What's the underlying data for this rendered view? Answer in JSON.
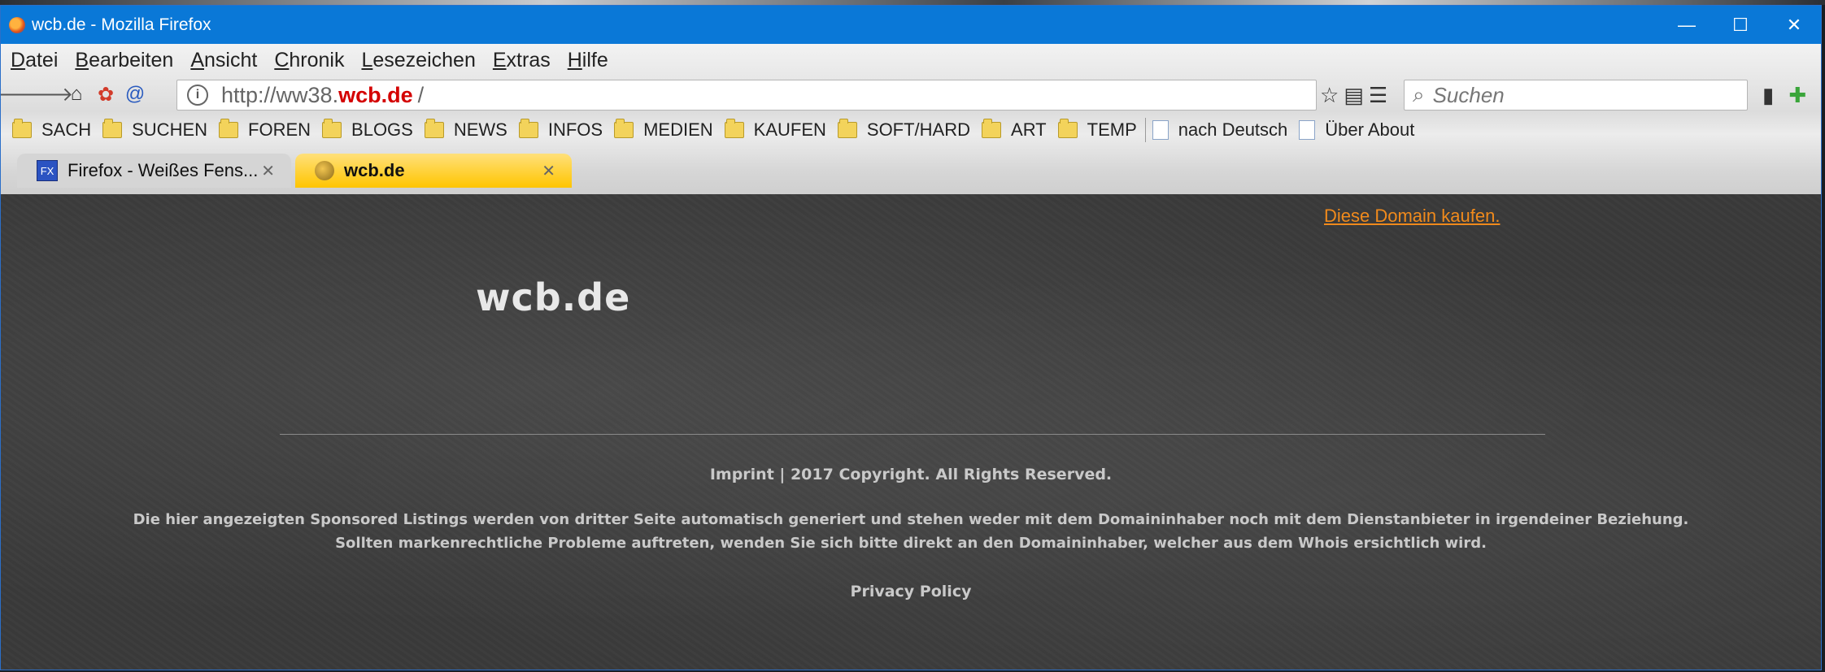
{
  "window": {
    "title": "wcb.de - Mozilla Firefox",
    "controls": {
      "minimize": "—",
      "maximize": "☐",
      "close": "✕"
    }
  },
  "menubar": {
    "items": [
      {
        "first": "D",
        "rest": "atei"
      },
      {
        "first": "B",
        "rest": "earbeiten"
      },
      {
        "first": "A",
        "rest": "nsicht"
      },
      {
        "first": "C",
        "rest": "hronik"
      },
      {
        "first": "L",
        "rest": "esezeichen"
      },
      {
        "first": "E",
        "rest": "xtras"
      },
      {
        "first": "H",
        "rest": "ilfe"
      }
    ]
  },
  "navbar": {
    "url_prefix": "http://ww38.",
    "url_domain": "wcb.de",
    "url_suffix": "/",
    "search_placeholder": "Suchen"
  },
  "bookmarks": {
    "folders": [
      "SACH",
      "SUCHEN",
      "FOREN",
      "BLOGS",
      "NEWS",
      "INFOS",
      "MEDIEN",
      "KAUFEN",
      "SOFT/HARD",
      "ART",
      "TEMP"
    ],
    "pages": [
      "nach Deutsch",
      "Über About"
    ]
  },
  "tabs": [
    {
      "label": "Firefox - Weißes Fens...",
      "favicon": "FX"
    },
    {
      "label": "wcb.de",
      "active": true
    }
  ],
  "page": {
    "buy_link": "Diese Domain kaufen.",
    "title": "wcb.de",
    "footer_line1": "Imprint | 2017 Copyright. All Rights Reserved.",
    "footer_line2": "Die hier angezeigten Sponsored Listings werden von dritter Seite automatisch generiert und stehen weder mit dem Domaininhaber noch mit dem Dienstanbieter in irgendeiner Beziehung.",
    "footer_line3": "Sollten markenrechtliche Probleme auftreten, wenden Sie sich bitte direkt an den Domaininhaber, welcher aus dem Whois ersichtlich wird.",
    "privacy": "Privacy Policy"
  },
  "colors": {
    "titlebar": "#0a78d7",
    "active_tab": "#ffc500",
    "url_domain": "#d40000",
    "buy_link": "#f08a1c"
  }
}
